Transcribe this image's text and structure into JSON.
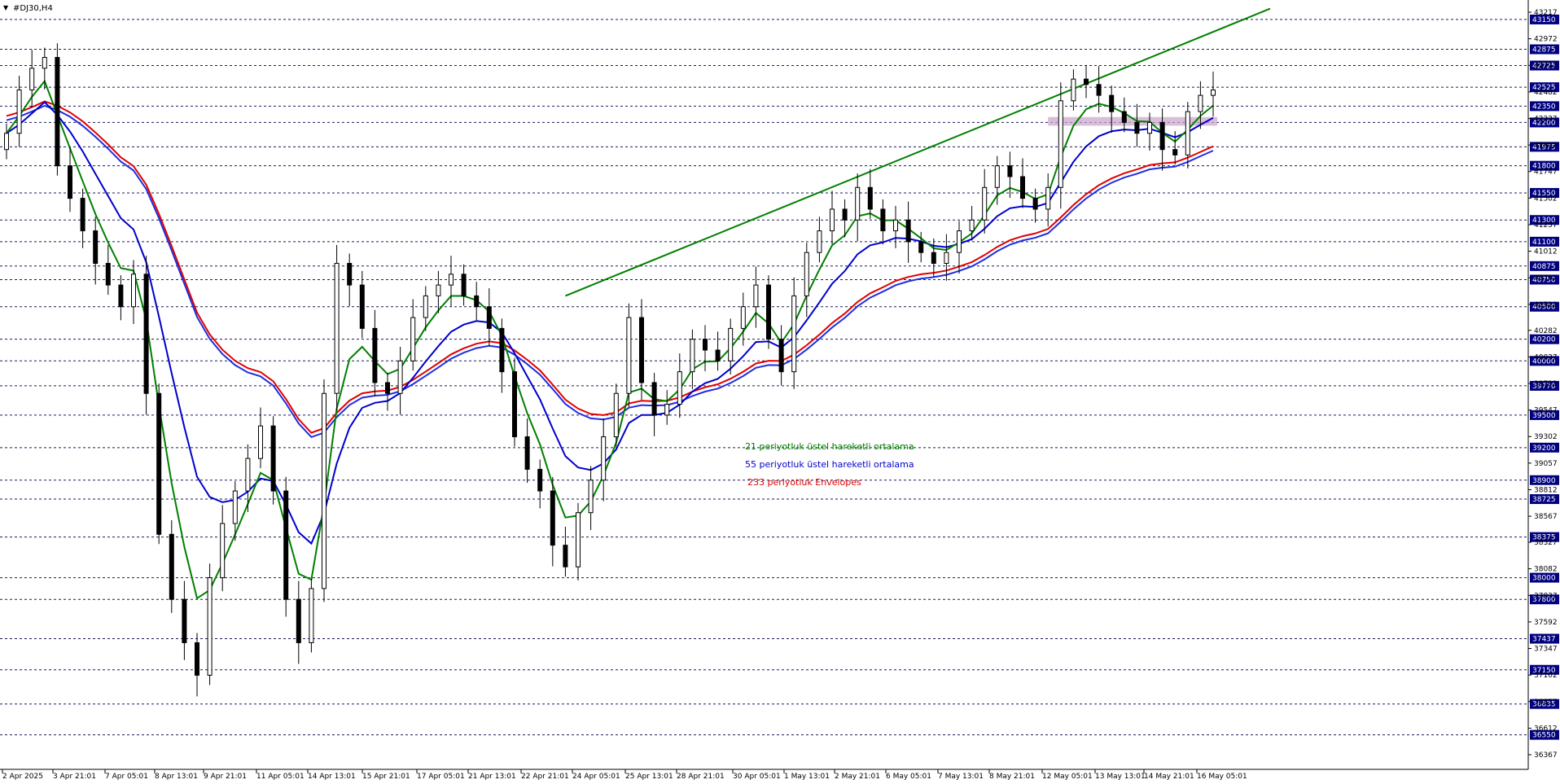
{
  "window": {
    "symbol_title": "#DJ30,H4"
  },
  "colors": {
    "background": "#ffffff",
    "bull_candle": "#ffffff",
    "bear_candle": "#000000",
    "ema21": "#008000",
    "ema55": "#0000cd",
    "envelope_upper": "#e00000",
    "envelope_lower": "#1f2ee0",
    "trendline": "#008000",
    "zone": "#c8a2c8",
    "level_box": "#000080",
    "dashed_level": "#1a1a5a"
  },
  "legend": [
    {
      "text": "21 periyotluk üstel hareketli ortalama",
      "color": "#008000"
    },
    {
      "text": "55 periyotluk üstel hareketli ortalama",
      "color": "#0000cd"
    },
    {
      "text": "233 periyotluk Envelopes",
      "color": "#e00000"
    }
  ],
  "chart_data": {
    "type": "candlestick",
    "symbol": "#DJ30",
    "timeframe": "H4",
    "ylim": [
      36367,
      43217
    ],
    "y_ticks": [
      "43217",
      "42972",
      "42727",
      "42482",
      "42237",
      "41992",
      "41747",
      "41502",
      "41257",
      "41012",
      "40767",
      "40522",
      "40282",
      "40037",
      "39792",
      "39547",
      "39302",
      "39057",
      "38812",
      "38567",
      "38327",
      "38082",
      "37837",
      "37592",
      "37347",
      "37102",
      "36857",
      "36612",
      "36367"
    ],
    "levels": [
      "43150",
      "42875",
      "42725",
      "42525",
      "42350",
      "42200",
      "41975",
      "41800",
      "41550",
      "41300",
      "41100",
      "40875",
      "40750",
      "40500",
      "40200",
      "40000",
      "39770",
      "39500",
      "39200",
      "38900",
      "38725",
      "38375",
      "38000",
      "37800",
      "37437",
      "37150",
      "36835",
      "36550"
    ],
    "x_labels": [
      "2 Apr 2025",
      "3 Apr 21:01",
      "7 Apr 05:01",
      "8 Apr 13:01",
      "9 Apr 21:01",
      "11 Apr 05:01",
      "14 Apr 13:01",
      "15 Apr 21:01",
      "17 Apr 05:01",
      "21 Apr 13:01",
      "22 Apr 21:01",
      "24 Apr 05:01",
      "25 Apr 13:01",
      "28 Apr 21:01",
      "30 Apr 05:01",
      "1 May 13:01",
      "2 May 21:01",
      "6 May 05:01",
      "7 May 13:01",
      "8 May 21:01",
      "12 May 05:01",
      "13 May 13:01",
      "14 May 21:01",
      "16 May 05:01"
    ],
    "candles_close": [
      42100,
      42500,
      42700,
      42800,
      41800,
      41500,
      41200,
      40900,
      40700,
      40500,
      40800,
      39700,
      38400,
      37800,
      37400,
      37100,
      38000,
      38500,
      38800,
      39100,
      39400,
      38800,
      37800,
      37400,
      37900,
      39700,
      40900,
      40700,
      40300,
      39800,
      39700,
      40000,
      40400,
      40600,
      40700,
      40800,
      40600,
      40500,
      40300,
      39900,
      39300,
      39000,
      38800,
      38300,
      38100,
      38600,
      38900,
      39300,
      39700,
      40400,
      39800,
      39500,
      39600,
      39900,
      40200,
      40100,
      40000,
      40300,
      40500,
      40700,
      40200,
      39900,
      40600,
      41000,
      41200,
      41400,
      41300,
      41600,
      41400,
      41200,
      41300,
      41100,
      41000,
      40900,
      41000,
      41200,
      41300,
      41600,
      41800,
      41700,
      41500,
      41400,
      41600,
      42400,
      42600,
      42550,
      42450,
      42300,
      42200,
      42100,
      42200,
      41950,
      41900,
      42300,
      42450,
      42500
    ],
    "ema21_last": 42200,
    "ema55_last": 41800,
    "envelope_last": 41270,
    "trendline": {
      "from": 40600,
      "to": 43250
    },
    "zone": {
      "low": 42170,
      "high": 42250
    },
    "legend_placement": "center"
  }
}
